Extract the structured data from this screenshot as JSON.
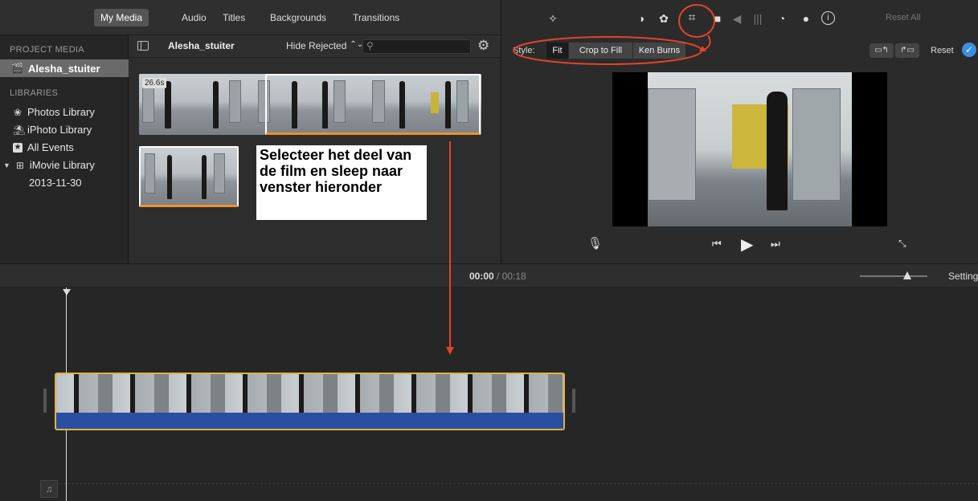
{
  "tabs": [
    {
      "label": "My Media",
      "active": true
    },
    {
      "label": "Audio",
      "active": false
    },
    {
      "label": "Titles",
      "active": false
    },
    {
      "label": "Backgrounds",
      "active": false
    },
    {
      "label": "Transitions",
      "active": false
    }
  ],
  "sidebar": {
    "project_media_heading": "PROJECT MEDIA",
    "project_item": "Alesha_stuiter",
    "libraries_heading": "LIBRARIES",
    "libraries": [
      {
        "label": "Photos Library",
        "icon": "photos-icon"
      },
      {
        "label": "iPhoto Library",
        "icon": "iphoto-icon"
      },
      {
        "label": "All Events",
        "icon": "star-icon"
      },
      {
        "label": "iMovie Library",
        "icon": "grid-icon"
      }
    ],
    "event_date": "2013-11-30"
  },
  "media_header": {
    "title": "Alesha_stuiter",
    "filter": "Hide Rejected",
    "filter_arrows": "⌃⌄",
    "search_placeholder": ""
  },
  "browser": {
    "duration_badge": "26.6s",
    "annotation": "Selecteer het deel van de film en sleep naar venster hieronder"
  },
  "viewer": {
    "style_label": "Style:",
    "style_options": [
      {
        "label": "Fit",
        "active": true
      },
      {
        "label": "Crop to Fill",
        "active": false
      },
      {
        "label": "Ken Burns",
        "active": false
      }
    ],
    "reset_all": "Reset All",
    "reset": "Reset"
  },
  "timeline": {
    "current_time": "00:00",
    "separator": "/",
    "total_time": "00:18",
    "settings_label": "Settings"
  },
  "colors": {
    "accent_orange": "#f0902a",
    "annotation_red": "#e0442a",
    "clip_selected_border": "#e2b33a",
    "audio_blue": "#2a4ea0",
    "reset_check_blue": "#3b8fe0"
  }
}
